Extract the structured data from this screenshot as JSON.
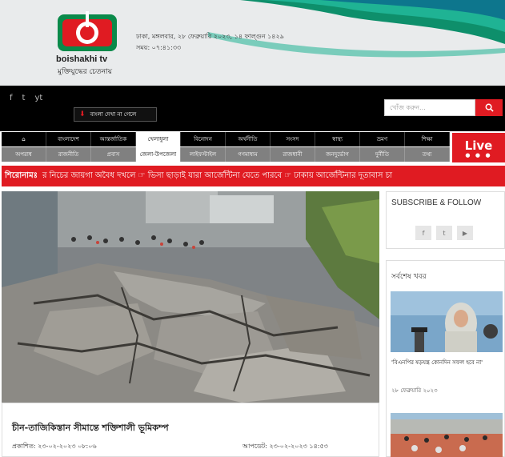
{
  "header": {
    "brand": "boishakhi tv",
    "tagline": "মুক্তিযুদ্ধের চেতনায়",
    "date_line": "ঢাকা, মঙ্গলবার, ২৮ ফেব্রুয়ারি ২০২৩, ১৪ ফাল্গুন ১৪২৯",
    "time_line": "সময়: ০৭:৪১:৩৩"
  },
  "topbar": {
    "social": [
      "f",
      "t",
      "yt"
    ],
    "download_label": "বাংলা দেখা না গেলে",
    "search_placeholder": "খোঁজ করুন..."
  },
  "nav": {
    "row1": [
      "⌂",
      "বাংলাদেশ",
      "আন্তর্জাতিক",
      "খেলাধুলা",
      "বিনোদন",
      "অর্থনীতি",
      "সংসদ",
      "স্বাস্থ্য",
      "ভ্রমণ",
      "শিক্ষা"
    ],
    "row2": [
      "অপরাধ",
      "রাজনীতি",
      "প্রবাস",
      "জেলা-উপজেলা",
      "লাইফস্টাইল",
      "গণমাধ্যম",
      "রাজধানী",
      "জনদুর্ভোগ",
      "দুর্নীতি",
      "তথ্য"
    ],
    "live_label": "Live",
    "live_dots": "● ● ●"
  },
  "ticker": {
    "label": "শিরোনামঃ",
    "text": "র নিচের জায়গা অবৈধ দখলে  ☞ ভিসা ছাড়াই যারা আর্জেন্টিনা যেতে পারবে  ☞ ঢাকায় আর্জেন্টিনার দূতাবাস চা"
  },
  "article": {
    "title": "চীন-তাজিকিস্তান সীমান্তে শক্তিশালী ভূমিকম্প",
    "published": "প্রকাশিত: ২৩-০২-২০২৩ ০৮:০৬",
    "updated": "আপডেট: ২৩-০২-২০২৩ ১৪:৫৩"
  },
  "sidebar": {
    "subscribe_title": "SUBSCRIBE & FOLLOW",
    "subscribe_icons": [
      "f",
      "t",
      "▶"
    ],
    "latest_title": "সর্বশেষ খবর",
    "latest_caption": "'বিএনপির ষড়যন্ত্র কোনদিন সফল হবে না'",
    "latest_date": "২৮ ফেব্রুয়ারি ২০২৩"
  },
  "colors": {
    "brand_red": "#e01b22",
    "brand_green": "#0a8a4a",
    "nav_black": "#000000",
    "nav_grey": "#808080"
  }
}
